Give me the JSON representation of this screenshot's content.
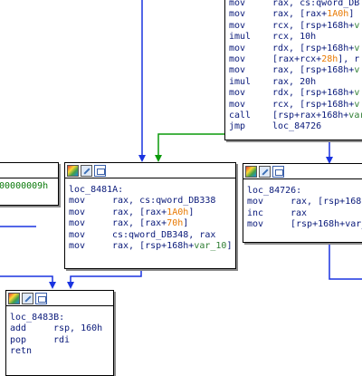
{
  "nodes": {
    "top_right": {
      "lines": [
        {
          "m": "mov",
          "o": [
            {
              "t": "rax, cs:qword_DB"
            }
          ]
        },
        {
          "m": "mov",
          "o": [
            {
              "t": "rax, [rax+"
            },
            {
              "t": "1A0h",
              "k": "num"
            },
            {
              "t": "]"
            }
          ]
        },
        {
          "m": "mov",
          "o": [
            {
              "t": "rcx, [rsp+168h+"
            },
            {
              "t": "v",
              "k": "var"
            }
          ]
        },
        {
          "m": "imul",
          "o": [
            {
              "t": "rcx, 10h"
            }
          ]
        },
        {
          "m": "mov",
          "o": [
            {
              "t": "rdx, [rsp+168h+"
            },
            {
              "t": "v",
              "k": "var"
            }
          ]
        },
        {
          "m": "mov",
          "o": [
            {
              "t": "[rax+rcx+"
            },
            {
              "t": "28h",
              "k": "num"
            },
            {
              "t": "], r"
            }
          ]
        },
        {
          "m": "mov",
          "o": [
            {
              "t": "rax, [rsp+168h+"
            },
            {
              "t": "v",
              "k": "var"
            }
          ]
        },
        {
          "m": "imul",
          "o": [
            {
              "t": "rax, 20h"
            }
          ]
        },
        {
          "m": "mov",
          "o": [
            {
              "t": "rdx, [rsp+168h+"
            },
            {
              "t": "v",
              "k": "var"
            }
          ]
        },
        {
          "m": "mov",
          "o": [
            {
              "t": "rcx, [rsp+168h+"
            },
            {
              "t": "v",
              "k": "var"
            }
          ]
        },
        {
          "m": "call",
          "o": [
            {
              "t": "[rsp+rax+168h+"
            },
            {
              "t": "var",
              "k": "var"
            }
          ]
        },
        {
          "m": "jmp",
          "o": [
            {
              "t": "loc_84726"
            }
          ]
        }
      ]
    },
    "left_partial": {
      "lines": [
        {
          "m": "",
          "o": [
            {
              "t": "000000009h",
              "k": "green"
            }
          ]
        }
      ]
    },
    "loc_8481A": {
      "label": "loc_8481A:",
      "lines": [
        {
          "m": "mov",
          "o": [
            {
              "t": "rax, cs:qword_DB338"
            }
          ]
        },
        {
          "m": "mov",
          "o": [
            {
              "t": "rax, [rax+"
            },
            {
              "t": "1A0h",
              "k": "num"
            },
            {
              "t": "]"
            }
          ]
        },
        {
          "m": "mov",
          "o": [
            {
              "t": "rax, [rax+"
            },
            {
              "t": "70h",
              "k": "num"
            },
            {
              "t": "]"
            }
          ]
        },
        {
          "m": "mov",
          "o": [
            {
              "t": "cs:qword_DB348, rax"
            }
          ]
        },
        {
          "m": "mov",
          "o": [
            {
              "t": "rax, [rsp+168h+"
            },
            {
              "t": "var_10",
              "k": "var"
            },
            {
              "t": "]"
            }
          ]
        }
      ]
    },
    "loc_84726": {
      "label": "loc_84726:",
      "lines": [
        {
          "m": "mov",
          "o": [
            {
              "t": "rax, [rsp+168h"
            }
          ]
        },
        {
          "m": "inc",
          "o": [
            {
              "t": "rax"
            }
          ]
        },
        {
          "m": "mov",
          "o": [
            {
              "t": "[rsp+168h+var_"
            }
          ]
        }
      ]
    },
    "loc_8483B": {
      "label": "loc_8483B:",
      "lines": [
        {
          "m": "add",
          "o": [
            {
              "t": "rsp, 160h"
            }
          ]
        },
        {
          "m": "pop",
          "o": [
            {
              "t": "rdi"
            }
          ]
        },
        {
          "m": "retn",
          "o": []
        }
      ]
    }
  },
  "icons": [
    "color-palette-icon",
    "edit-node-icon",
    "graph-overview-icon"
  ],
  "colors": {
    "edge_blue": "#1a33e0",
    "edge_green": "#0a9a0a",
    "text_dark_blue": "#0a1a7a",
    "number_orange": "#e87800",
    "var_green": "#2e7d32"
  }
}
